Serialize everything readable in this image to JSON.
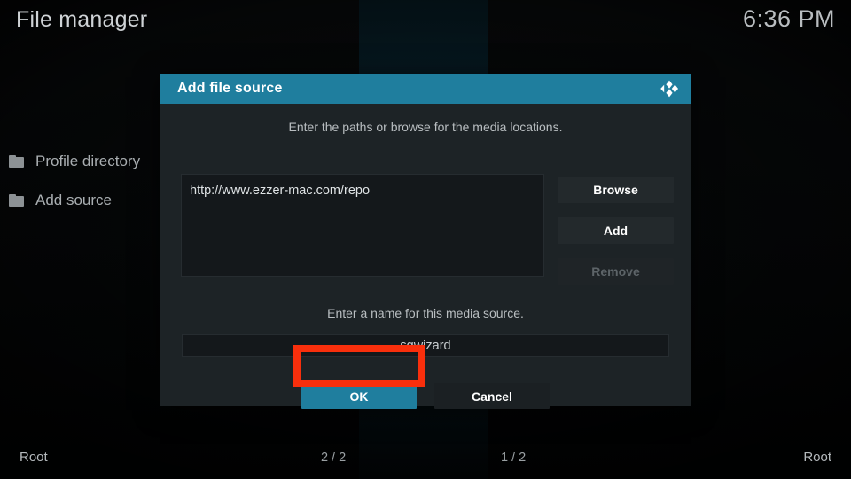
{
  "header": {
    "title": "File manager",
    "clock": "6:36 PM"
  },
  "filelist": {
    "items": [
      {
        "icon": "folder-icon",
        "label": "Profile directory"
      },
      {
        "icon": "folder-icon",
        "label": "Add source"
      }
    ]
  },
  "dialog": {
    "title": "Add file source",
    "logo_icon": "kodi-logo-icon",
    "hint_paths": "Enter the paths or browse for the media locations.",
    "path_entries": [
      "http://www.ezzer-mac.com/repo"
    ],
    "side_buttons": [
      {
        "label": "Browse",
        "disabled": false
      },
      {
        "label": "Add",
        "disabled": false
      },
      {
        "label": "Remove",
        "disabled": true
      }
    ],
    "hint_name": "Enter a name for this media source.",
    "name_value": "sgwizard",
    "ok_label": "OK",
    "cancel_label": "Cancel"
  },
  "annotation": {
    "highlight_color": "#f92f0c",
    "target": "OK"
  },
  "bottombar": {
    "root_left": "Root",
    "count_left": "2 / 2",
    "count_right": "1 / 2",
    "root_right": "Root"
  },
  "colors": {
    "accent_teal": "#1f7e9e",
    "dialog_bg": "#1d2326",
    "field_bg": "#14181b",
    "highlight_red": "#f92f0c"
  }
}
